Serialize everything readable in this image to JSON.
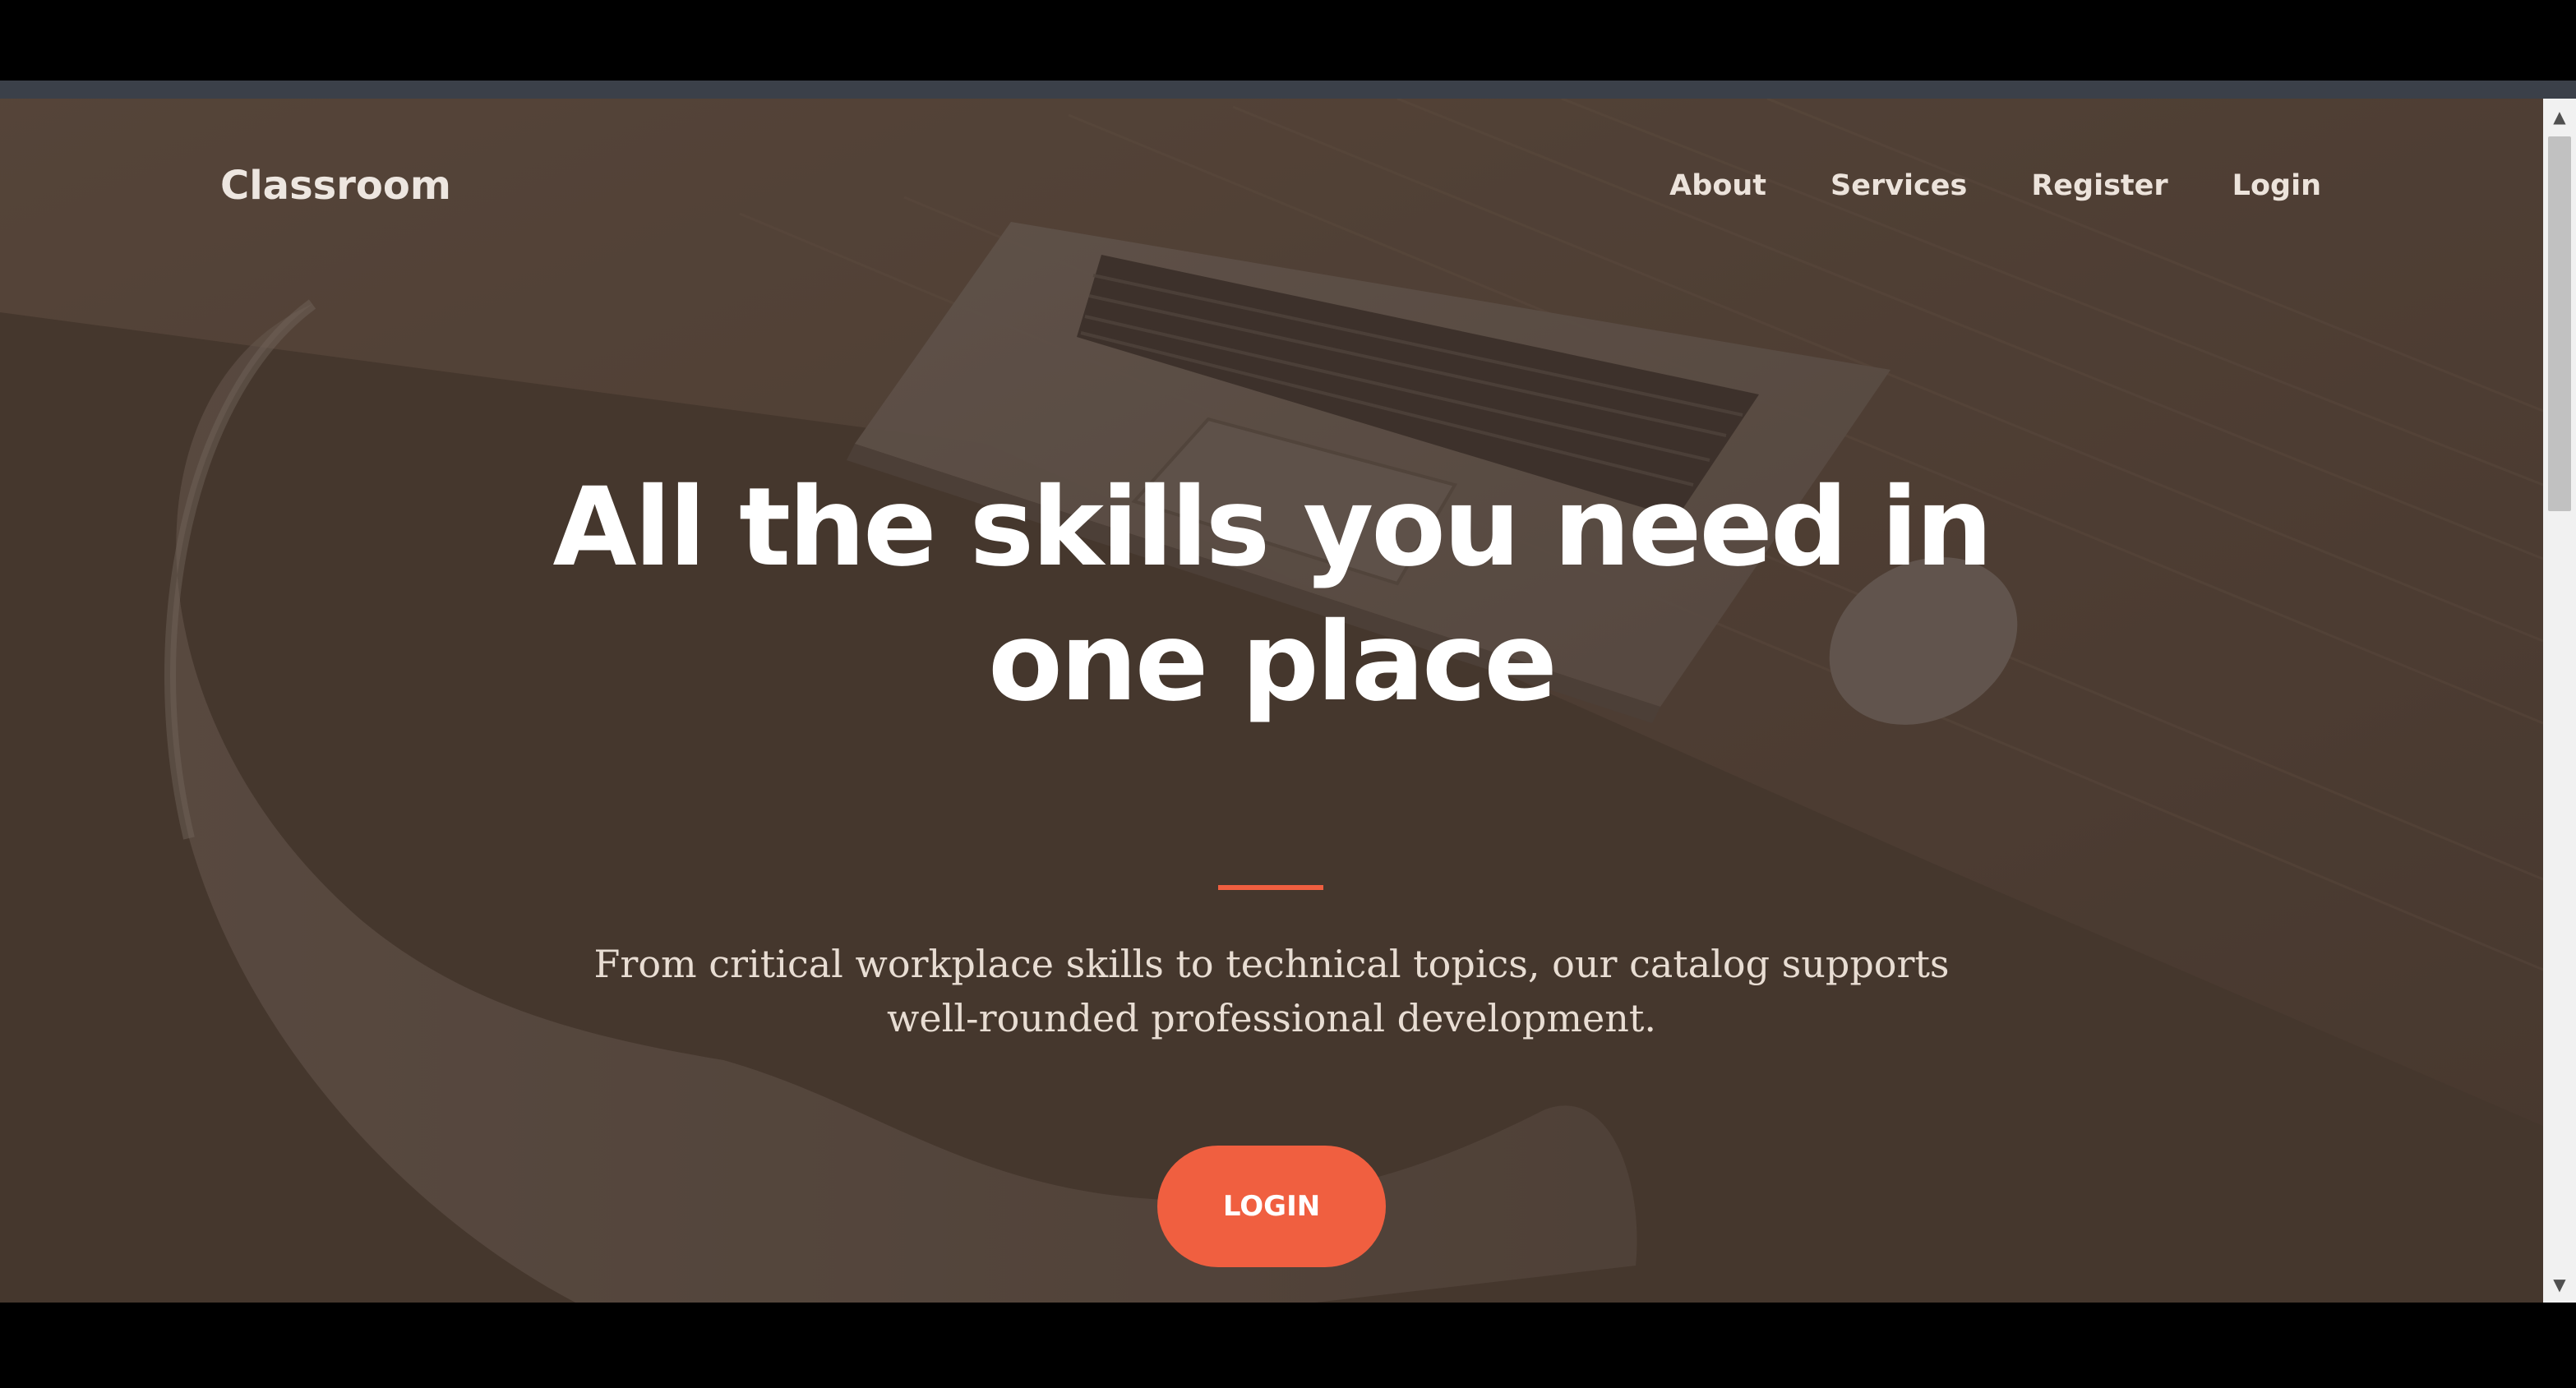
{
  "navbar": {
    "brand": "Classroom",
    "links": [
      "About",
      "Services",
      "Register",
      "Login"
    ]
  },
  "hero": {
    "title_line1": "All the skills you need in",
    "title_line2": "one place",
    "subtitle_line1": "From critical workplace skills to technical topics, our catalog supports",
    "subtitle_line2": "well-rounded professional development.",
    "button_label": "LOGIN"
  },
  "colors": {
    "accent": "#f05f40",
    "background": "#4e4036",
    "text": "#ffffff"
  },
  "scrollbar": {
    "up_icon": "▲",
    "down_icon": "▼"
  }
}
